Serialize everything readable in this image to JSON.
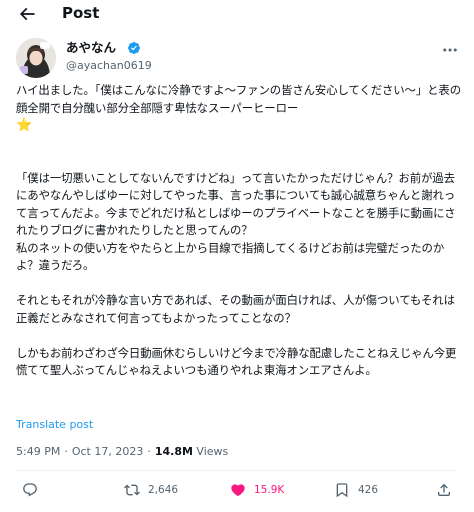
{
  "header": {
    "title": "Post"
  },
  "author": {
    "display_name": "あやなん",
    "handle": "@ayachan0619"
  },
  "tweet": {
    "paragraphs": [
      "ハイ出ました。「僕はこんなに冷静ですよ〜ファンの皆さん安心してください〜」と表の顔全開で自分醜い部分全部隠す卑怯なスーパーヒーロー",
      "「僕は一切悪いことしてないんですけどね」って言いたかっただけじゃん？お前が過去にあやなんやしばゆーに対してやった事、言った事についても誠心誠意ちゃんと謝れって言ってんだよ。今までどれだけ私としばゆーのプライベートなことを勝手に動画にされたりブログに書かれたりしたと思ってんの？\n私のネットの使い方をやたらと上から目線で指摘してくるけどお前は完璧だったのかよ？違うだろ。",
      "それともそれが冷静な言い方であれば、その動画が面白ければ、人が傷ついてもそれは正義だとみなされて何言ってもよかったってことなの？",
      "しかもお前わざわざ今日動画休むらしいけど今まで冷静な配慮したことねえじゃん今更慌てて聖人ぶってんじゃねえよいつも通りやれよ東海オンエアさんよ。"
    ],
    "star_emoji": "⭐",
    "translate_label": "Translate post",
    "time": "5:49 PM",
    "date": "Oct 17, 2023",
    "views_count": "14.8M",
    "views_label": "Views"
  },
  "actions": {
    "replies": "",
    "retweets": "2,646",
    "likes": "15.9K",
    "bookmarks": "426"
  },
  "colors": {
    "accent": "#1d9bf0",
    "like": "#f91880",
    "muted": "#536471",
    "text": "#0f1419"
  },
  "icons": [
    "back-arrow-icon",
    "verified-badge-icon",
    "more-icon",
    "reply-icon",
    "retweet-icon",
    "like-heart-icon",
    "bookmark-icon",
    "share-icon",
    "star-emoji"
  ]
}
